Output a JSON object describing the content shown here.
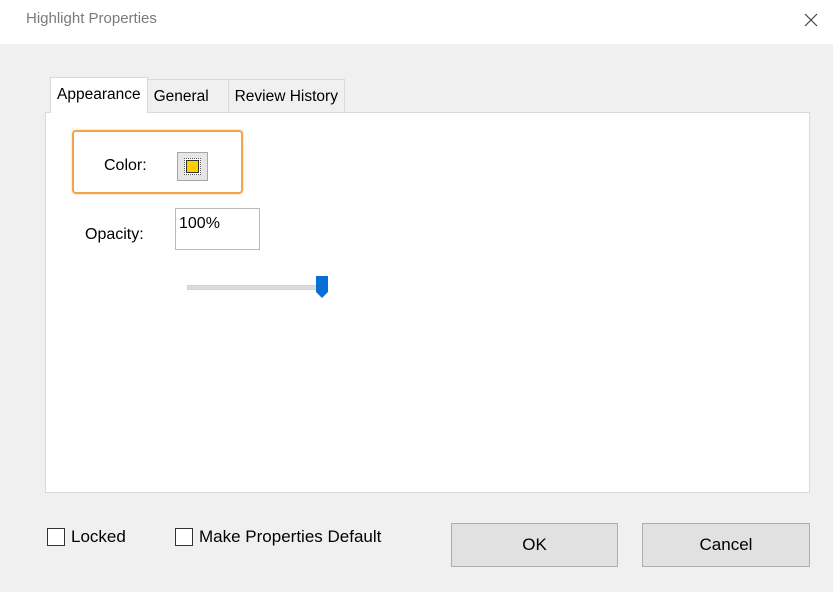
{
  "window": {
    "title": "Highlight Properties",
    "close_icon": "close-icon"
  },
  "tabs": [
    {
      "label": "Appearance",
      "active": true
    },
    {
      "label": "General",
      "active": false
    },
    {
      "label": "Review History",
      "active": false
    }
  ],
  "appearance": {
    "color_label": "Color:",
    "color_value": "#ffd100",
    "highlight_border_color": "#f2a44a",
    "opacity_label": "Opacity:",
    "opacity_value": "100%",
    "opacity_slider_fraction": 1.0
  },
  "footer": {
    "locked_label": "Locked",
    "locked_checked": false,
    "default_label": "Make Properties Default",
    "default_checked": false,
    "ok_label": "OK",
    "cancel_label": "Cancel"
  }
}
